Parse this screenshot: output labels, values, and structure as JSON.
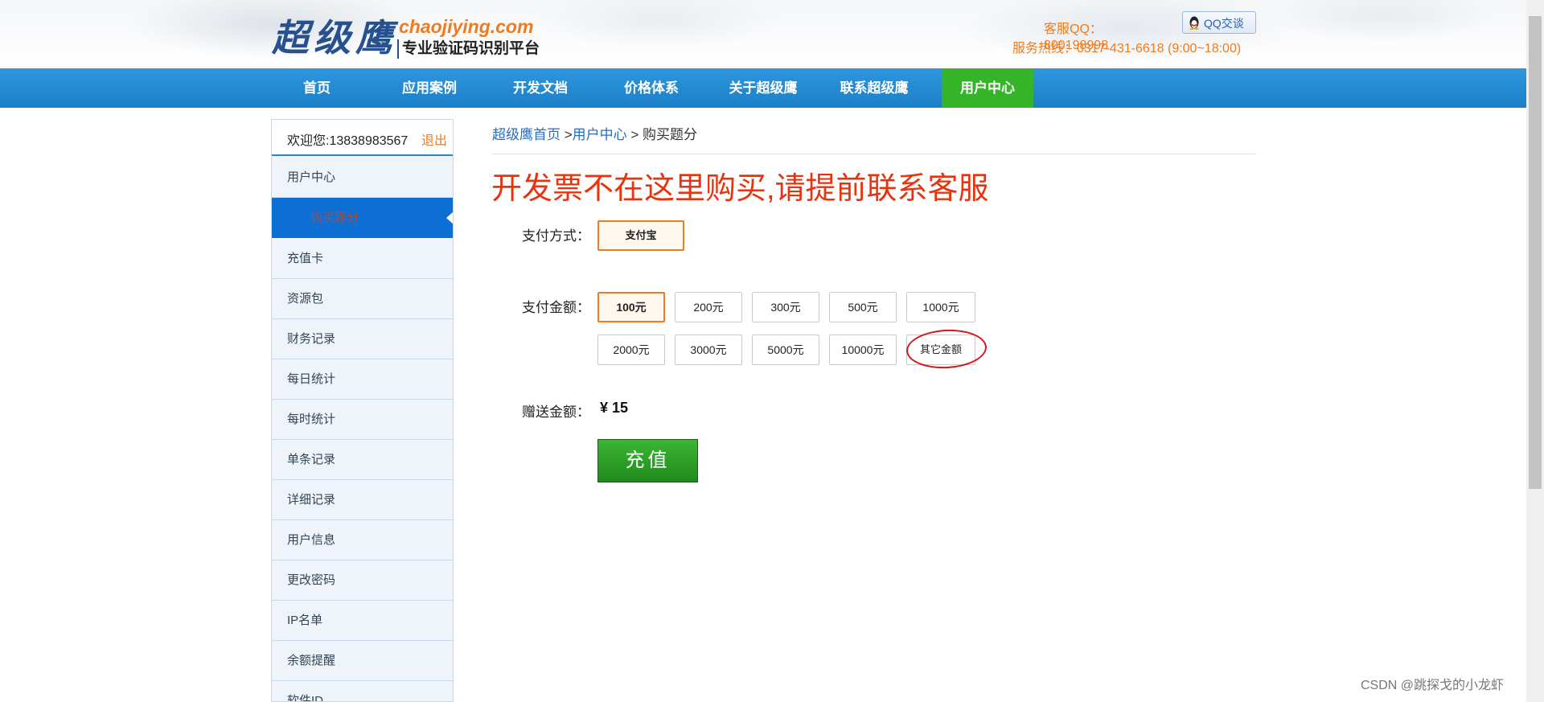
{
  "header": {
    "logo_cn": "超级鹰",
    "logo_url": "chaojiying.com",
    "logo_sub": "专业验证码识别平台",
    "service_qq": "客服QQ：800198998",
    "qq_button": "QQ交谈",
    "service_tel": "服务热线：0317-431-6618 (9:00~18:00)"
  },
  "nav": {
    "items": [
      "首页",
      "应用案例",
      "开发文档",
      "价格体系",
      "关于超级鹰",
      "联系超级鹰",
      "用户中心"
    ],
    "active": "用户中心",
    "active_color": "#35b42a",
    "bar_color": "#1f87cf"
  },
  "sidebar": {
    "welcome": "欢迎您:13838983567",
    "logout": "退出",
    "items": [
      "用户中心",
      "购买题分",
      "充值卡",
      "资源包",
      "财务记录",
      "每日统计",
      "每时统计",
      "单条记录",
      "详细记录",
      "用户信息",
      "更改密码",
      "IP名单",
      "余额提醒",
      "软件ID"
    ],
    "selected": "购买题分"
  },
  "breadcrumb": {
    "home": "超级鹰首页",
    "sep1": " >",
    "center": "用户中心",
    "sep2": " > ",
    "current": "购买题分"
  },
  "notice": "开发票不在这里购买,请提前联系客服",
  "form": {
    "pay_method_label": "支付方式：",
    "pay_methods": [
      "支付宝"
    ],
    "amount_label": "支付金额：",
    "amounts_row1": [
      "100元",
      "200元",
      "300元",
      "500元",
      "1000元"
    ],
    "amounts_row2": [
      "2000元",
      "3000元",
      "5000元",
      "10000元",
      "其它金额"
    ],
    "selected_amount": "100元",
    "bonus_label": "赠送金额：",
    "bonus_value": "¥ 15",
    "submit": "充值"
  },
  "watermark": "CSDN @跳探戈的小龙虾",
  "colors": {
    "accent_orange": "#f07a1c",
    "notice_red": "#e8340e",
    "sidebar_selected": "#0d6fd3",
    "submit_green": "#2aa024"
  }
}
